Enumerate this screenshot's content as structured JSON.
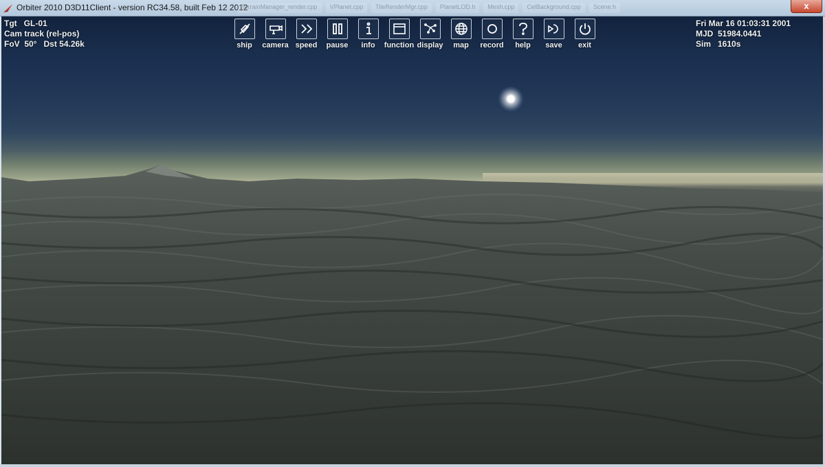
{
  "window": {
    "title": "Orbiter 2010 D3D11Client - version RC34.58, built Feb 12 2012",
    "close_label": "x",
    "background_tabs": [
      "TerrainManager_render.cpp",
      "VPlanet.cpp",
      "TileRenderMgr.cpp",
      "PlanetLOD.h",
      "Mesh.cpp",
      "CelBackground.cpp",
      "Scene.h"
    ]
  },
  "hud_left": {
    "tgt": "Tgt   GL-01",
    "cam": "Cam track (rel-pos)",
    "fov": "FoV  50°   Dst 54.26k"
  },
  "hud_right": {
    "date": "Fri Mar 16 01:03:31 2001",
    "mjd": "MJD  51984.0441",
    "sim": "Sim   1610s"
  },
  "toolbar": [
    {
      "label": "ship",
      "icon": "ship-icon"
    },
    {
      "label": "camera",
      "icon": "camera-icon"
    },
    {
      "label": "speed",
      "icon": "fast-forward-icon"
    },
    {
      "label": "pause",
      "icon": "pause-icon"
    },
    {
      "label": "info",
      "icon": "info-icon"
    },
    {
      "label": "function",
      "icon": "window-icon"
    },
    {
      "label": "display",
      "icon": "stars-icon"
    },
    {
      "label": "map",
      "icon": "globe-icon"
    },
    {
      "label": "record",
      "icon": "record-icon"
    },
    {
      "label": "help",
      "icon": "question-icon"
    },
    {
      "label": "save",
      "icon": "save-icon"
    },
    {
      "label": "exit",
      "icon": "power-icon"
    }
  ]
}
